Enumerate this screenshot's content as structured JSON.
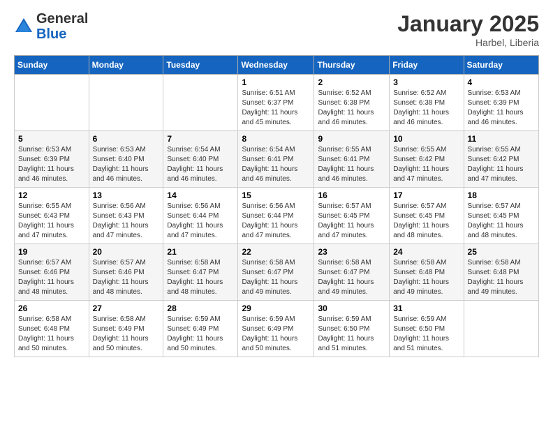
{
  "header": {
    "logo_general": "General",
    "logo_blue": "Blue",
    "title": "January 2025",
    "location": "Harbel, Liberia"
  },
  "days_of_week": [
    "Sunday",
    "Monday",
    "Tuesday",
    "Wednesday",
    "Thursday",
    "Friday",
    "Saturday"
  ],
  "weeks": [
    [
      {
        "day": "",
        "sunrise": "",
        "sunset": "",
        "daylight": ""
      },
      {
        "day": "",
        "sunrise": "",
        "sunset": "",
        "daylight": ""
      },
      {
        "day": "",
        "sunrise": "",
        "sunset": "",
        "daylight": ""
      },
      {
        "day": "1",
        "sunrise": "Sunrise: 6:51 AM",
        "sunset": "Sunset: 6:37 PM",
        "daylight": "Daylight: 11 hours and 45 minutes."
      },
      {
        "day": "2",
        "sunrise": "Sunrise: 6:52 AM",
        "sunset": "Sunset: 6:38 PM",
        "daylight": "Daylight: 11 hours and 46 minutes."
      },
      {
        "day": "3",
        "sunrise": "Sunrise: 6:52 AM",
        "sunset": "Sunset: 6:38 PM",
        "daylight": "Daylight: 11 hours and 46 minutes."
      },
      {
        "day": "4",
        "sunrise": "Sunrise: 6:53 AM",
        "sunset": "Sunset: 6:39 PM",
        "daylight": "Daylight: 11 hours and 46 minutes."
      }
    ],
    [
      {
        "day": "5",
        "sunrise": "Sunrise: 6:53 AM",
        "sunset": "Sunset: 6:39 PM",
        "daylight": "Daylight: 11 hours and 46 minutes."
      },
      {
        "day": "6",
        "sunrise": "Sunrise: 6:53 AM",
        "sunset": "Sunset: 6:40 PM",
        "daylight": "Daylight: 11 hours and 46 minutes."
      },
      {
        "day": "7",
        "sunrise": "Sunrise: 6:54 AM",
        "sunset": "Sunset: 6:40 PM",
        "daylight": "Daylight: 11 hours and 46 minutes."
      },
      {
        "day": "8",
        "sunrise": "Sunrise: 6:54 AM",
        "sunset": "Sunset: 6:41 PM",
        "daylight": "Daylight: 11 hours and 46 minutes."
      },
      {
        "day": "9",
        "sunrise": "Sunrise: 6:55 AM",
        "sunset": "Sunset: 6:41 PM",
        "daylight": "Daylight: 11 hours and 46 minutes."
      },
      {
        "day": "10",
        "sunrise": "Sunrise: 6:55 AM",
        "sunset": "Sunset: 6:42 PM",
        "daylight": "Daylight: 11 hours and 47 minutes."
      },
      {
        "day": "11",
        "sunrise": "Sunrise: 6:55 AM",
        "sunset": "Sunset: 6:42 PM",
        "daylight": "Daylight: 11 hours and 47 minutes."
      }
    ],
    [
      {
        "day": "12",
        "sunrise": "Sunrise: 6:55 AM",
        "sunset": "Sunset: 6:43 PM",
        "daylight": "Daylight: 11 hours and 47 minutes."
      },
      {
        "day": "13",
        "sunrise": "Sunrise: 6:56 AM",
        "sunset": "Sunset: 6:43 PM",
        "daylight": "Daylight: 11 hours and 47 minutes."
      },
      {
        "day": "14",
        "sunrise": "Sunrise: 6:56 AM",
        "sunset": "Sunset: 6:44 PM",
        "daylight": "Daylight: 11 hours and 47 minutes."
      },
      {
        "day": "15",
        "sunrise": "Sunrise: 6:56 AM",
        "sunset": "Sunset: 6:44 PM",
        "daylight": "Daylight: 11 hours and 47 minutes."
      },
      {
        "day": "16",
        "sunrise": "Sunrise: 6:57 AM",
        "sunset": "Sunset: 6:45 PM",
        "daylight": "Daylight: 11 hours and 47 minutes."
      },
      {
        "day": "17",
        "sunrise": "Sunrise: 6:57 AM",
        "sunset": "Sunset: 6:45 PM",
        "daylight": "Daylight: 11 hours and 48 minutes."
      },
      {
        "day": "18",
        "sunrise": "Sunrise: 6:57 AM",
        "sunset": "Sunset: 6:45 PM",
        "daylight": "Daylight: 11 hours and 48 minutes."
      }
    ],
    [
      {
        "day": "19",
        "sunrise": "Sunrise: 6:57 AM",
        "sunset": "Sunset: 6:46 PM",
        "daylight": "Daylight: 11 hours and 48 minutes."
      },
      {
        "day": "20",
        "sunrise": "Sunrise: 6:57 AM",
        "sunset": "Sunset: 6:46 PM",
        "daylight": "Daylight: 11 hours and 48 minutes."
      },
      {
        "day": "21",
        "sunrise": "Sunrise: 6:58 AM",
        "sunset": "Sunset: 6:47 PM",
        "daylight": "Daylight: 11 hours and 48 minutes."
      },
      {
        "day": "22",
        "sunrise": "Sunrise: 6:58 AM",
        "sunset": "Sunset: 6:47 PM",
        "daylight": "Daylight: 11 hours and 49 minutes."
      },
      {
        "day": "23",
        "sunrise": "Sunrise: 6:58 AM",
        "sunset": "Sunset: 6:47 PM",
        "daylight": "Daylight: 11 hours and 49 minutes."
      },
      {
        "day": "24",
        "sunrise": "Sunrise: 6:58 AM",
        "sunset": "Sunset: 6:48 PM",
        "daylight": "Daylight: 11 hours and 49 minutes."
      },
      {
        "day": "25",
        "sunrise": "Sunrise: 6:58 AM",
        "sunset": "Sunset: 6:48 PM",
        "daylight": "Daylight: 11 hours and 49 minutes."
      }
    ],
    [
      {
        "day": "26",
        "sunrise": "Sunrise: 6:58 AM",
        "sunset": "Sunset: 6:48 PM",
        "daylight": "Daylight: 11 hours and 50 minutes."
      },
      {
        "day": "27",
        "sunrise": "Sunrise: 6:58 AM",
        "sunset": "Sunset: 6:49 PM",
        "daylight": "Daylight: 11 hours and 50 minutes."
      },
      {
        "day": "28",
        "sunrise": "Sunrise: 6:59 AM",
        "sunset": "Sunset: 6:49 PM",
        "daylight": "Daylight: 11 hours and 50 minutes."
      },
      {
        "day": "29",
        "sunrise": "Sunrise: 6:59 AM",
        "sunset": "Sunset: 6:49 PM",
        "daylight": "Daylight: 11 hours and 50 minutes."
      },
      {
        "day": "30",
        "sunrise": "Sunrise: 6:59 AM",
        "sunset": "Sunset: 6:50 PM",
        "daylight": "Daylight: 11 hours and 51 minutes."
      },
      {
        "day": "31",
        "sunrise": "Sunrise: 6:59 AM",
        "sunset": "Sunset: 6:50 PM",
        "daylight": "Daylight: 11 hours and 51 minutes."
      },
      {
        "day": "",
        "sunrise": "",
        "sunset": "",
        "daylight": ""
      }
    ]
  ]
}
